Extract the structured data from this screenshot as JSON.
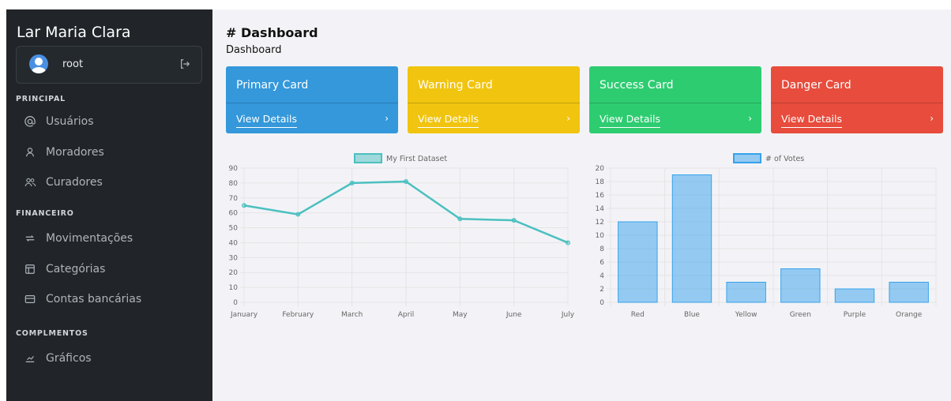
{
  "sidebar": {
    "app_title": "Lar Maria Clara",
    "user": {
      "name": "root"
    },
    "sections": [
      {
        "label": "PRINCIPAL",
        "items": [
          {
            "label": "Usuários",
            "icon": "at-icon"
          },
          {
            "label": "Moradores",
            "icon": "user-icon"
          },
          {
            "label": "Curadores",
            "icon": "users-icon"
          }
        ]
      },
      {
        "label": "FINANCEIRO",
        "items": [
          {
            "label": "Movimentações",
            "icon": "arrows-icon"
          },
          {
            "label": "Categórias",
            "icon": "table-icon"
          },
          {
            "label": "Contas bancárias",
            "icon": "credit-card-icon"
          }
        ]
      },
      {
        "label": "COMPLMENTOS",
        "items": [
          {
            "label": "Gráficos",
            "icon": "chart-icon"
          }
        ]
      }
    ]
  },
  "header": {
    "title": "# Dashboard",
    "breadcrumb": "Dashboard"
  },
  "cards": [
    {
      "title": "Primary Card",
      "link": "View Details",
      "color": "#3498db"
    },
    {
      "title": "Warning Card",
      "link": "View Details",
      "color": "#f1c40f"
    },
    {
      "title": "Success Card",
      "link": "View Details",
      "color": "#2ecc71"
    },
    {
      "title": "Danger Card",
      "link": "View Details",
      "color": "#e74c3c"
    }
  ],
  "chart_data": [
    {
      "type": "line",
      "categories": [
        "January",
        "February",
        "March",
        "April",
        "May",
        "June",
        "July"
      ],
      "series": [
        {
          "name": "My First Dataset",
          "values": [
            65,
            59,
            80,
            81,
            56,
            55,
            40
          ],
          "color": "#4bc0c0"
        }
      ],
      "yticks": [
        0,
        10,
        20,
        30,
        40,
        50,
        60,
        70,
        80,
        90
      ],
      "ylim": [
        0,
        90
      ],
      "grid": true,
      "legend": "top"
    },
    {
      "type": "bar",
      "categories": [
        "Red",
        "Blue",
        "Yellow",
        "Green",
        "Purple",
        "Orange"
      ],
      "series": [
        {
          "name": "# of Votes",
          "values": [
            12,
            19,
            3,
            5,
            2,
            3
          ],
          "color": "#36a2eb"
        }
      ],
      "yticks": [
        0,
        2,
        4,
        6,
        8,
        10,
        12,
        14,
        16,
        18,
        20
      ],
      "ylim": [
        0,
        20
      ],
      "grid": true,
      "legend": "top"
    }
  ]
}
